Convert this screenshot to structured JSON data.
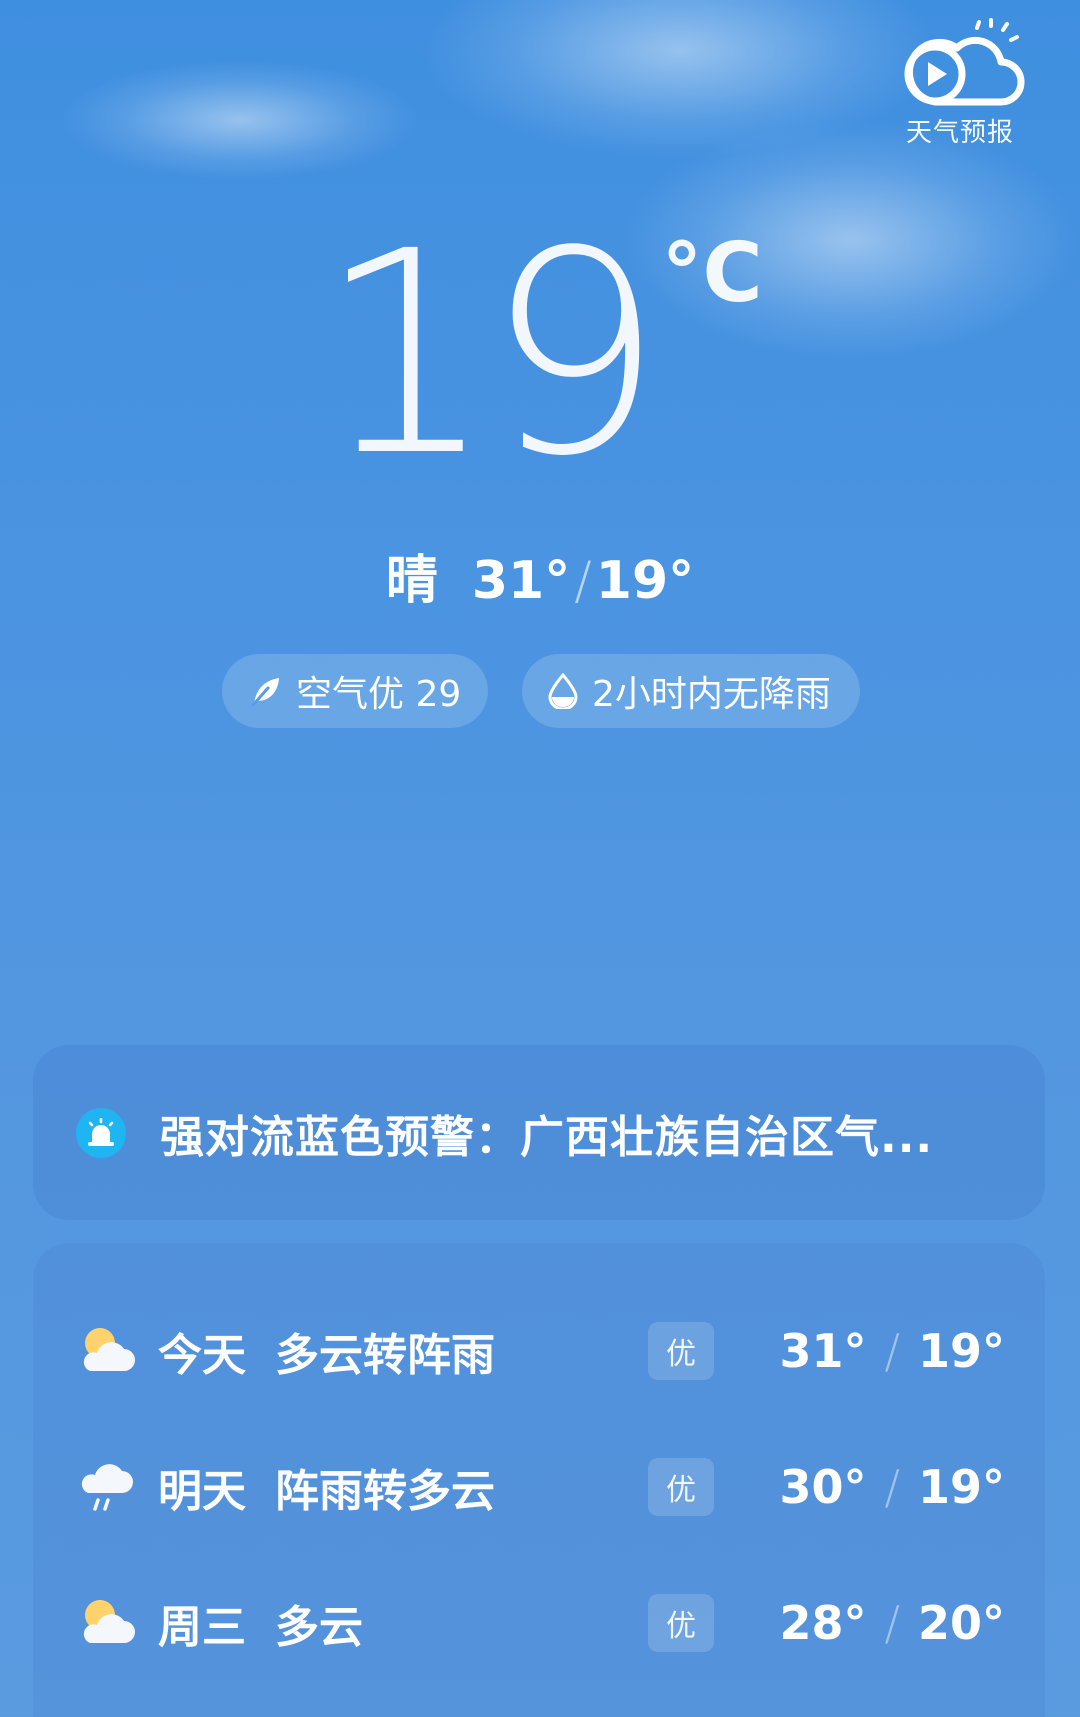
{
  "forecast_video": {
    "label": "天气预报",
    "icon": "play-cloud-sun-icon"
  },
  "current": {
    "temperature": "19",
    "unit": "°C",
    "condition": "晴",
    "high": "31°",
    "low": "19°",
    "separator": "/"
  },
  "pills": {
    "air": {
      "label": "空气优 29",
      "icon": "leaf-icon"
    },
    "rain": {
      "label": "2小时内无降雨",
      "icon": "raindrop-icon"
    }
  },
  "alert": {
    "text": "强对流蓝色预警：广西壮族自治区气...",
    "icon": "alert-siren-icon",
    "icon_color": "#1fb5f2"
  },
  "forecast": [
    {
      "day": "今天",
      "condition": "多云转阵雨",
      "aqi": "优",
      "high": "31°",
      "sep": "/",
      "low": "19°",
      "icon": "partly-cloudy-icon"
    },
    {
      "day": "明天",
      "condition": "阵雨转多云",
      "aqi": "优",
      "high": "30°",
      "sep": "/",
      "low": "19°",
      "icon": "rain-cloud-icon"
    },
    {
      "day": "周三",
      "condition": "多云",
      "aqi": "优",
      "high": "28°",
      "sep": "/",
      "low": "20°",
      "icon": "partly-cloudy-icon"
    }
  ],
  "colors": {
    "sky_top": "#3f8fe0",
    "sky_bottom": "#5a9be0",
    "alert_icon": "#1fb5f2",
    "sun": "#ffd36b"
  }
}
